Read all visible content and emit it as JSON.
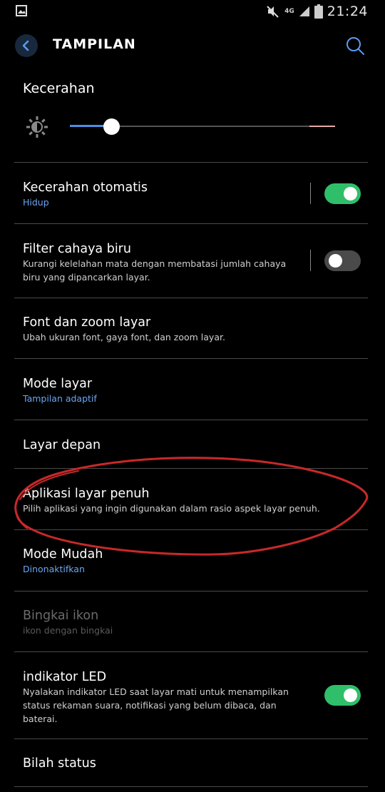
{
  "status_bar": {
    "time": "21:24",
    "network": "4G",
    "icons": [
      "gallery-icon",
      "mute-icon",
      "signal-icon",
      "battery-icon"
    ]
  },
  "app_bar": {
    "title": "TAMPILAN",
    "back_icon": "chevron-left-icon",
    "search_icon": "search-icon"
  },
  "brightness": {
    "title": "Kecerahan",
    "icon": "sun-icon",
    "level": 0.155
  },
  "settings": [
    {
      "title": "Kecerahan otomatis",
      "subtitle": "Hidup",
      "subtitle_style": "blue",
      "toggle": "on"
    },
    {
      "title": "Filter cahaya biru",
      "subtitle": "Kurangi kelelahan mata dengan membatasi jumlah cahaya biru yang dipancarkan layar.",
      "toggle": "off"
    },
    {
      "title": "Font dan zoom layar",
      "subtitle": "Ubah ukuran font, gaya font, dan zoom layar."
    },
    {
      "title": "Mode layar",
      "subtitle": "Tampilan adaptif",
      "subtitle_style": "blue"
    },
    {
      "title": "Layar depan"
    },
    {
      "title": "Aplikasi layar penuh",
      "subtitle": "Pilih aplikasi yang ingin digunakan dalam rasio aspek layar penuh."
    },
    {
      "title": "Mode Mudah",
      "subtitle": "Dinonaktifkan",
      "subtitle_style": "blue"
    },
    {
      "title": "Bingkai ikon",
      "subtitle": "ikon dengan bingkai",
      "disabled": true
    },
    {
      "title": "indikator LED",
      "subtitle": "Nyalakan indikator LED saat layar mati untuk menampilkan status rekaman suara, notifikasi yang belum dibaca, dan baterai.",
      "toggle": "on"
    },
    {
      "title": "Bilah status"
    }
  ],
  "colors": {
    "background": "#000000",
    "accent_blue": "#6aa6f0",
    "toggle_on": "#2fbf6a",
    "annotation_red": "#c8282a"
  }
}
